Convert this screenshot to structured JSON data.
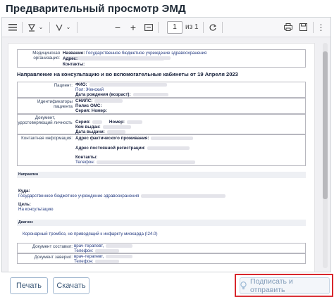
{
  "title": "Предварительный просмотр ЭМД",
  "toolbar": {
    "page_current": "1",
    "page_of": "из 1",
    "icons": [
      "sidebar-toggle-icon",
      "highlight-icon",
      "chevron-down-icon",
      "draw-icon",
      "chevron-down-icon",
      "zoom-out-icon",
      "zoom-in-icon",
      "fit-page-icon",
      "rotate-icon",
      "print-icon",
      "save-icon",
      "more-icon"
    ]
  },
  "document": {
    "org": {
      "label": "Медицинская организация:",
      "name_label": "Название:",
      "name_value": "Государственное бюджетное учреждение здравоохранения",
      "address_label": "Адрес:",
      "contacts_label": "Контакты:"
    },
    "heading": "Направление на консультацию и во вспомогательные кабинеты от 19 Апреля 2023",
    "patient": {
      "label": "Пациент:",
      "fio_label": "ФИО:",
      "sex_label": "Пол:",
      "sex_value": "Женский",
      "dob_label": "Дата рождения (возраст):"
    },
    "ids": {
      "label": "Идентификаторы пациента",
      "snils_label": "СНИЛС:",
      "oms_label": "Полис ОМС:",
      "series_label": "Серия:",
      "number_label": "Номер:"
    },
    "doc": {
      "label": "Документ, удостоверяющий личность",
      "series_label": "Серия:",
      "number_label": "Номер:",
      "issuer_label": "Кем выдан:",
      "date_label": "Дата выдачи:"
    },
    "contact": {
      "label": "Контактная информация:",
      "actual_addr_label": "Адрес фактического проживания:",
      "reg_addr_label": "Адрес постоянной регистрации:",
      "contacts_label": "Контакты:",
      "phone_label": "Телефон:"
    },
    "referral": {
      "band": "Направлен",
      "where_label": "Куда:",
      "where_value": "Государственное бюджетное учреждение здравоохранения",
      "goal_label": "Цель:",
      "goal_value": "На консультацию"
    },
    "diagnosis": {
      "band": "Диагноз",
      "value": "Коронарный тромбоз, не приводящий к инфаркту миокарда (I24.0)"
    },
    "composed": {
      "label": "Документ составил:",
      "role": "врач-терапевт,",
      "phone_label": "Телефон:"
    },
    "certified": {
      "label": "Документ заверил:",
      "role": "врач-терапевт,",
      "phone_label": "Телефон:"
    }
  },
  "footer": {
    "print_label": "Печать",
    "download_label": "Скачать",
    "send_label": "Подписать и отправить"
  },
  "colors": {
    "highlight_frame": "#d8262c",
    "button_border": "#9fb6cf",
    "button_text": "#3b5878"
  }
}
